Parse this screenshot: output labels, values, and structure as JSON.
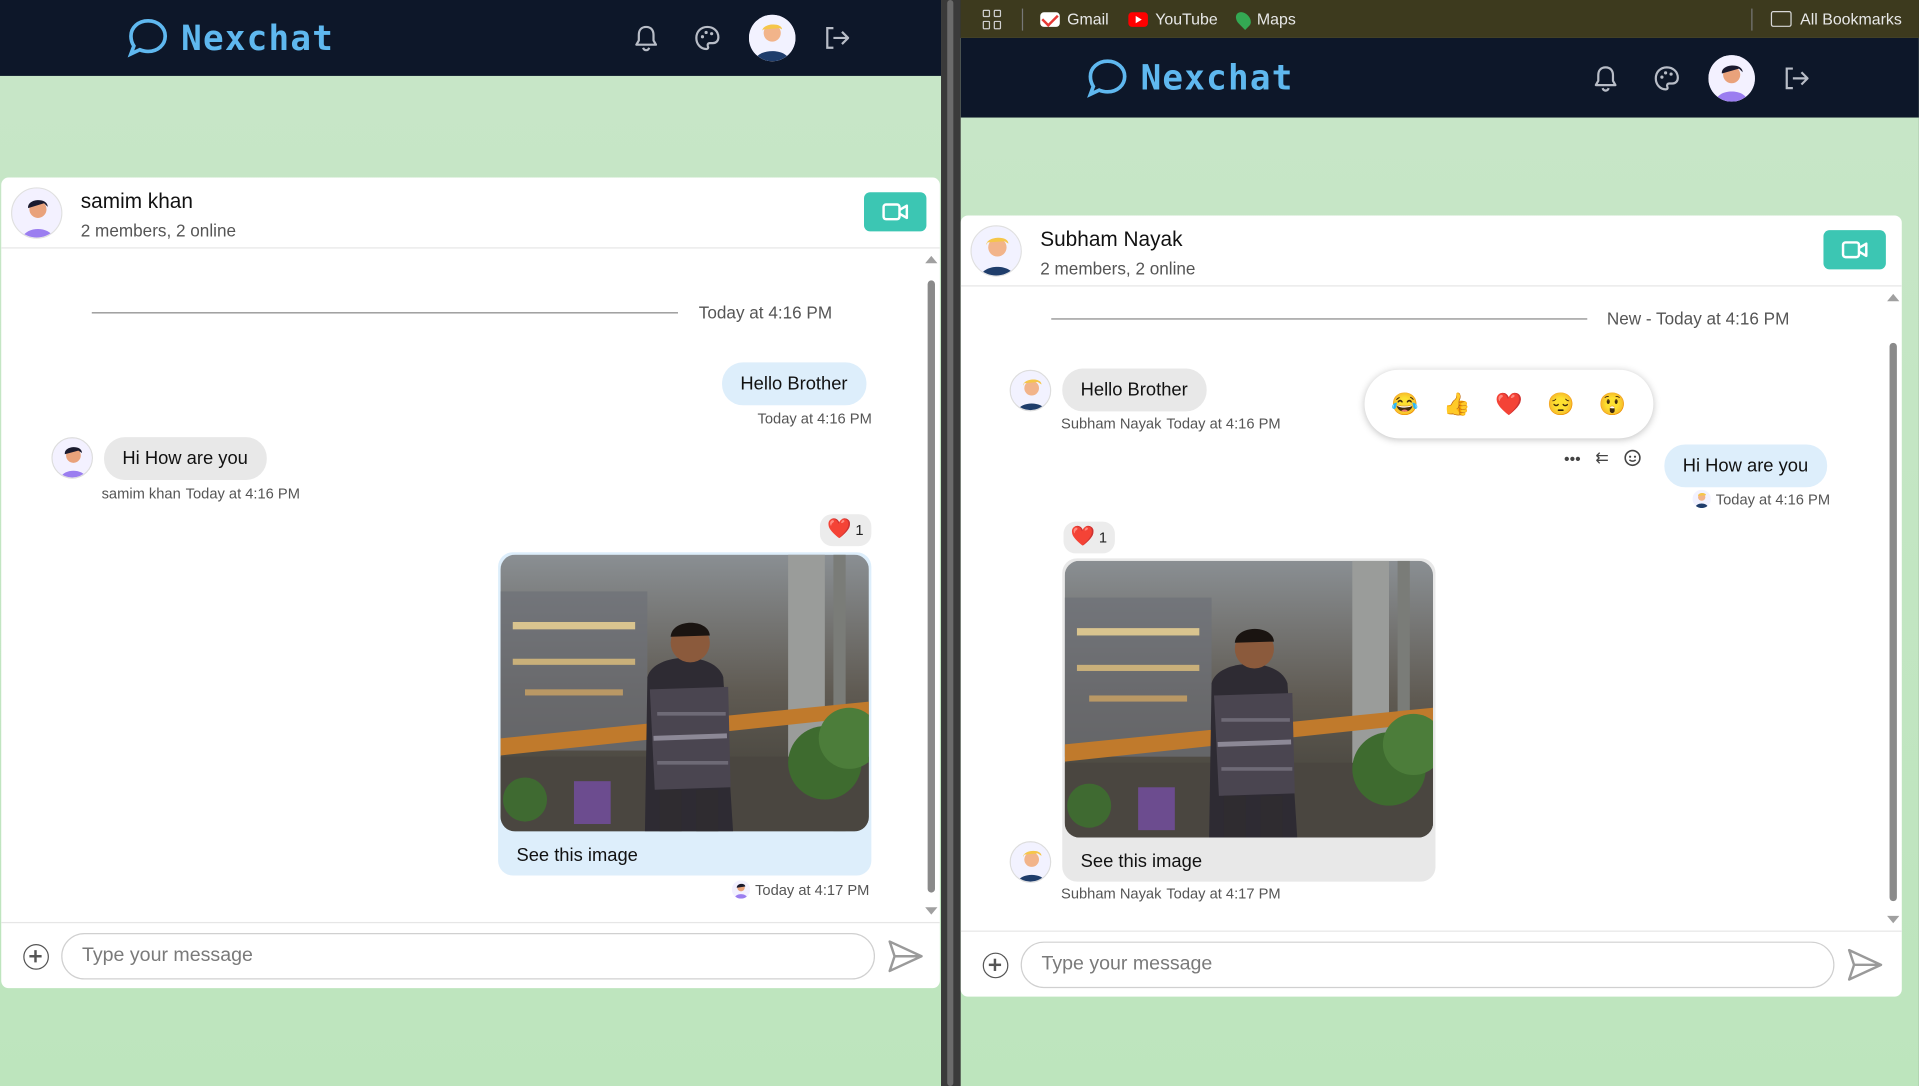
{
  "bookmarks": {
    "items": [
      {
        "label": "Gmail"
      },
      {
        "label": "YouTube"
      },
      {
        "label": "Maps"
      }
    ],
    "all_label": "All Bookmarks"
  },
  "app": {
    "brand": "Nexchat"
  },
  "left": {
    "header": {
      "name": "samim khan",
      "subtitle": "2 members, 2 online"
    },
    "day_label": "Today at 4:16 PM",
    "messages": [
      {
        "text": "Hello Brother",
        "time": "Today at 4:16 PM"
      },
      {
        "text": "Hi How are you",
        "sender": "samim khan",
        "time": "Today at 4:16 PM"
      }
    ],
    "image_message": {
      "reaction": "❤️",
      "reaction_count": "1",
      "caption": "See this image",
      "time": "Today at 4:17 PM"
    },
    "composer": {
      "placeholder": "Type your message"
    }
  },
  "right": {
    "header": {
      "name": "Subham Nayak",
      "subtitle": "2 members, 2 online"
    },
    "day_label": "New - Today at 4:16 PM",
    "messages": [
      {
        "text": "Hello Brother",
        "sender": "Subham Nayak",
        "time": "Today at 4:16 PM"
      },
      {
        "text": "Hi How are you",
        "time": "Today at 4:16 PM"
      }
    ],
    "reaction_picker": [
      "😂",
      "👍",
      "❤️",
      "😔",
      "😲"
    ],
    "message_tools": {
      "more": "•••",
      "reply": "⇇"
    },
    "image_message": {
      "reaction": "❤️",
      "reaction_count": "1",
      "caption": "See this image",
      "sender": "Subham Nayak",
      "time": "Today at 4:17 PM"
    },
    "composer": {
      "placeholder": "Type your message"
    }
  }
}
